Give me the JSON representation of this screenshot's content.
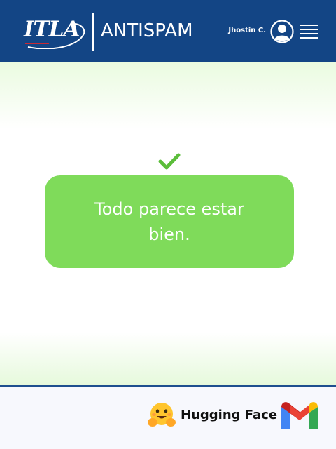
{
  "header": {
    "logo_text": "ITLA",
    "app_title": "ANTISPAM",
    "user_name": "Jhostin C.",
    "avatar_icon": "user-circle-icon",
    "menu_icon": "hamburger-menu-icon",
    "background_color": "#134585"
  },
  "status": {
    "icon": "checkmark-icon",
    "message": "Todo parece estar bien.",
    "box_color": "#7fdb5a",
    "check_color": "#5bbd3a"
  },
  "footer": {
    "hugging_face_label": "Hugging Face",
    "hugging_face_icon": "hugging-face-emoji-icon",
    "gmail_icon": "gmail-logo-icon"
  }
}
